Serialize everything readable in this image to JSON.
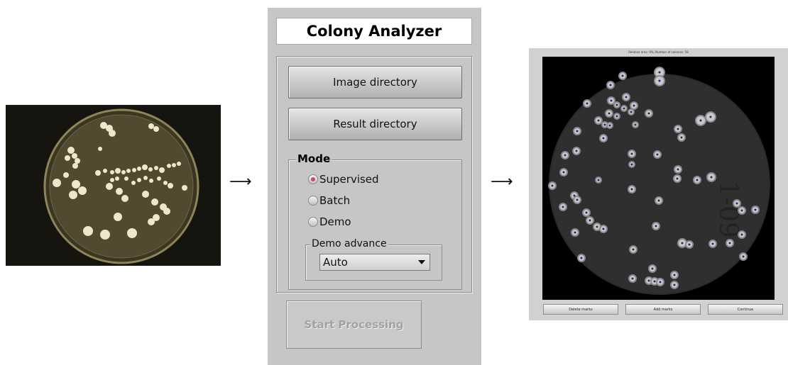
{
  "arrows": {
    "symbol": "⟶"
  },
  "panel": {
    "title": "Colony Analyzer",
    "buttons": {
      "image_directory": "Image directory",
      "result_directory": "Result directory",
      "start_processing": "Start Processing"
    },
    "mode": {
      "legend": "Mode",
      "options": [
        {
          "label": "Supervised",
          "checked": true
        },
        {
          "label": "Batch",
          "checked": false
        },
        {
          "label": "Demo",
          "checked": false
        }
      ]
    },
    "demo_advance": {
      "legend": "Demo advance",
      "selected": "Auto"
    },
    "colors": {
      "background": "#c6c6c6",
      "radio_selected": "#c84a78"
    }
  },
  "result_window": {
    "title": "Relative area: 9%, Number of colonies: 59",
    "buttons": {
      "delete_marks": "Delete marks",
      "add_marks": "Add marks",
      "continue": "Continue"
    }
  }
}
